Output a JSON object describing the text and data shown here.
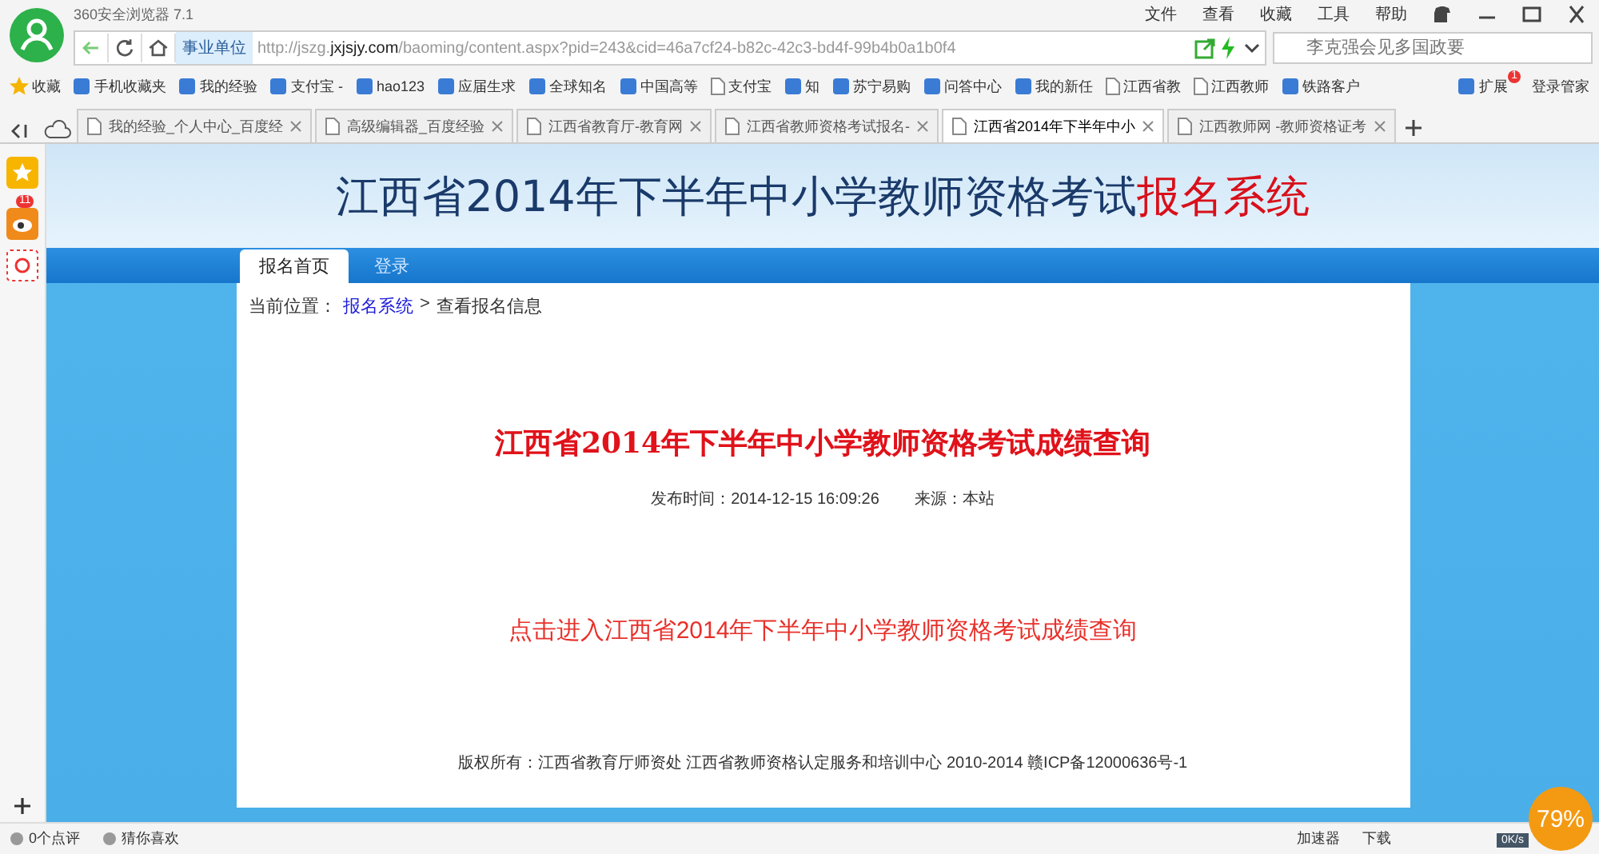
{
  "window": {
    "title": "360安全浏览器 7.1",
    "menu": [
      "文件",
      "查看",
      "收藏",
      "工具",
      "帮助"
    ]
  },
  "address": {
    "zone": "事业单位",
    "url_scheme": "http://jszg.",
    "url_domain": "jxjsjy.com",
    "url_path": "/baoming/content.aspx?pid=243&cid=46a7cf24-b82c-42c3-bd4f-99b4b0a1b0f4",
    "search_placeholder": "李克强会见多国政要"
  },
  "bookmarks": [
    {
      "label": "收藏",
      "kind": "star"
    },
    {
      "label": "手机收藏夹",
      "kind": "site"
    },
    {
      "label": "我的经验",
      "kind": "site"
    },
    {
      "label": "支付宝 -",
      "kind": "site"
    },
    {
      "label": "hao123",
      "kind": "site"
    },
    {
      "label": "应届生求",
      "kind": "site"
    },
    {
      "label": "全球知名",
      "kind": "site"
    },
    {
      "label": "中国高等",
      "kind": "site"
    },
    {
      "label": "支付宝",
      "kind": "page"
    },
    {
      "label": "知",
      "kind": "site"
    },
    {
      "label": "苏宁易购",
      "kind": "site"
    },
    {
      "label": "问答中心",
      "kind": "site"
    },
    {
      "label": "我的新任",
      "kind": "site"
    },
    {
      "label": "江西省教",
      "kind": "page"
    },
    {
      "label": "江西教师",
      "kind": "page"
    },
    {
      "label": "铁路客户",
      "kind": "site"
    }
  ],
  "extensions": {
    "label": "扩展",
    "badge": "1"
  },
  "login_manager": "登录管家",
  "tabs": [
    {
      "label": "我的经验_个人中心_百度经",
      "selected": false
    },
    {
      "label": "高级编辑器_百度经验",
      "selected": false
    },
    {
      "label": "江西省教育厅-教育网",
      "selected": false
    },
    {
      "label": "江西省教师资格考试报名-",
      "selected": false
    },
    {
      "label": "江西省2014年下半年中小",
      "selected": true
    },
    {
      "label": "江西教师网 -教师资格证考",
      "selected": false
    }
  ],
  "sidebar": {
    "badge": "11"
  },
  "page": {
    "banner_title": "江西省2014年下半年中小学教师资格考试",
    "banner_highlight": "报名系统",
    "nav": [
      {
        "label": "报名首页",
        "selected": true
      },
      {
        "label": "登录",
        "selected": false
      }
    ],
    "breadcrumb": {
      "label": "当前位置：",
      "link": "报名系统",
      "separator": ">",
      "current": "查看报名信息"
    },
    "article_title": "江西省2014年下半年中小学教师资格考试成绩查询",
    "published": "发布时间：2014-12-15 16:09:26",
    "source": "来源：本站",
    "link": "点击进入江西省2014年下半年中小学教师资格考试成绩查询",
    "footer": "版权所有：江西省教育厅师资处 江西省教师资格认定服务和培训中心 2010-2014 赣ICP备12000636号-1"
  },
  "status_bar": {
    "left": [
      "0个点评",
      "猜你喜欢"
    ],
    "right": [
      "加速器",
      "下载"
    ],
    "speed": "0K/s",
    "ball": "79%"
  }
}
